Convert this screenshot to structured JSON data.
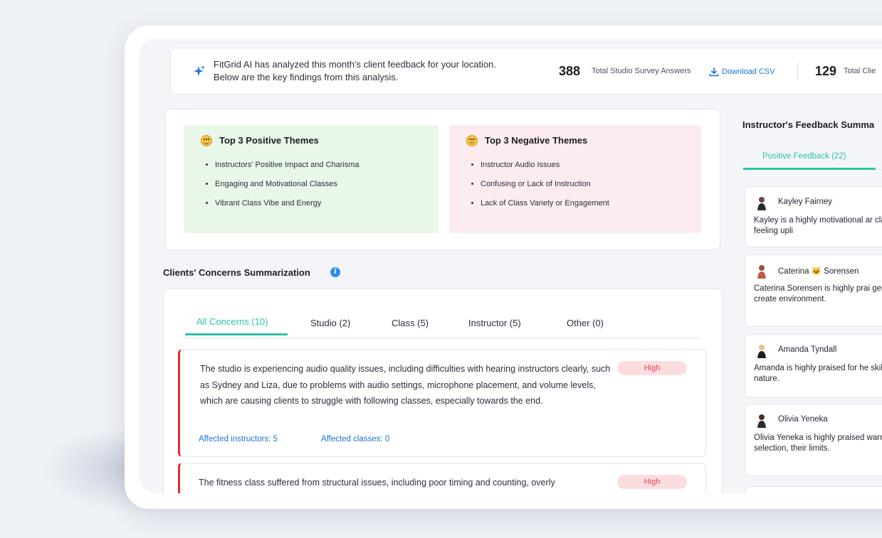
{
  "header": {
    "message": "FitGrid AI has analyzed this month's client feedback for your location. Below are the key findings from this analysis.",
    "stat1_value": "388",
    "stat1_label": "Total Studio Survey Answers",
    "download_label": "Download CSV",
    "stat2_value": "129",
    "stat2_label": "Total Clie"
  },
  "themes": {
    "positive": {
      "title": "Top 3 Positive Themes",
      "items": [
        "Instructors' Positive Impact and Charisma",
        "Engaging and Motivational Classes",
        "Vibrant Class Vibe and Energy"
      ]
    },
    "negative": {
      "title": "Top 3 Negative Themes",
      "items": [
        "Instructor Audio Issues",
        "Confusing or Lack of Instruction",
        "Lack of Class Variety or Engagement"
      ]
    }
  },
  "concerns": {
    "title": "Clients' Concerns Summarization",
    "tabs": [
      "All Concerns (10)",
      "Studio (2)",
      "Class (5)",
      "Instructor (5)",
      "Other (0)"
    ],
    "items": [
      {
        "text": "The studio is experiencing audio quality issues, including difficulties with hearing instructors clearly, such as Sydney and Liza, due to problems with audio settings, microphone placement, and volume levels, which are causing clients to struggle with following classes, especially towards the end.",
        "severity": "High",
        "affected_instructors": "Affected instructors:  5",
        "affected_classes": "Affected classes:  0"
      },
      {
        "text": "The fitness class suffered from structural issues, including poor timing and counting, overly",
        "severity": "High"
      }
    ]
  },
  "instructors": {
    "title": "Instructor's Feedback Summa",
    "tab_positive": "Positive Feedback (22)",
    "cards": [
      {
        "name": "Kayley Fairney",
        "desc": "Kayley is a highly motivational ar classes leave clients feeling upli"
      },
      {
        "name": "Caterina 🐱 Sorensen",
        "desc": "Caterina Sorensen is highly prai generosity, and ability to create environment."
      },
      {
        "name": "Amanda Tyndall",
        "desc": "Amanda is highly praised for he skills, and supportive nature."
      },
      {
        "name": "Olivia Yeneka",
        "desc": "Olivia Yeneka is highly praised warm energy, music selection, their limits."
      }
    ]
  },
  "colors": {
    "accent": "#2fc1a8",
    "link": "#1a73d9",
    "high_badge_bg": "#fbdde0",
    "high_badge_text": "#e2454f",
    "concern_border": "#e62b2b",
    "positive_bg": "#e9f7e9",
    "negative_bg": "#fcecef"
  }
}
